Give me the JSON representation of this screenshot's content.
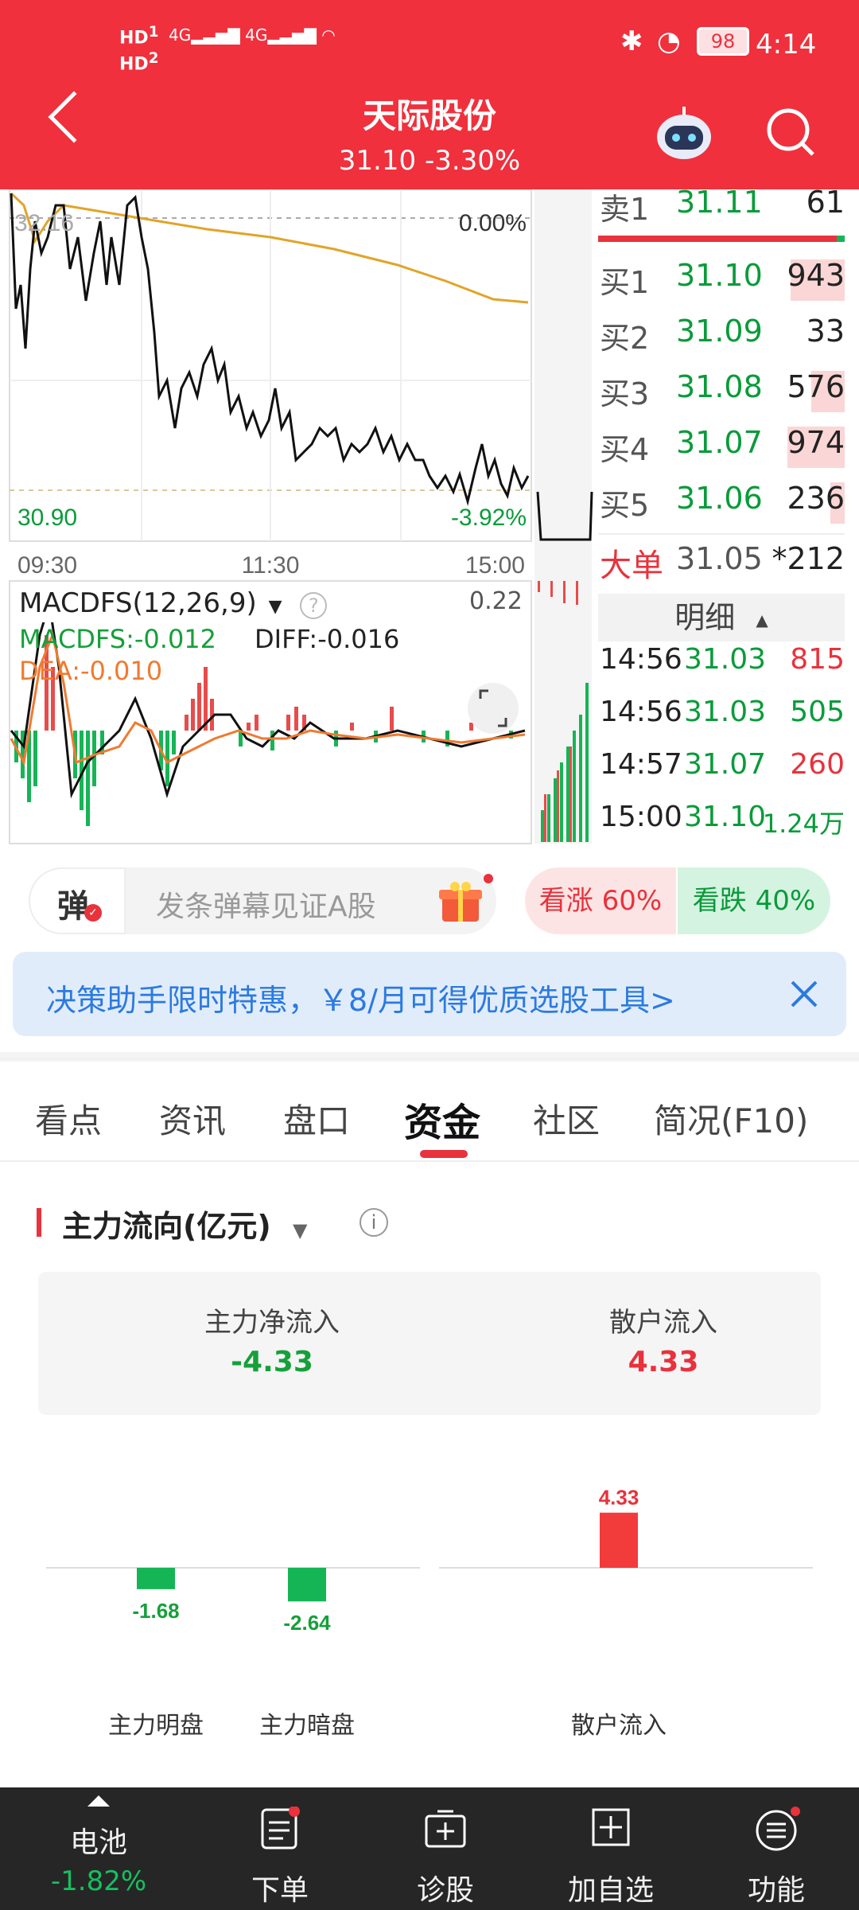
{
  "status_bar": {
    "network": "HD 4G 4G",
    "battery": "98",
    "time": "4:14"
  },
  "header": {
    "title": "天际股份",
    "price": "31.10",
    "change_pct": "-3.30%",
    "back": "back",
    "robot": "robot-assistant",
    "search": "search"
  },
  "chart": {
    "top_left_price": "32.16",
    "top_right_pct": "0.00%",
    "bottom_left_price": "30.90",
    "bottom_right_pct": "-3.92%",
    "times": [
      "09:30",
      "11:30",
      "15:00"
    ],
    "macd_title": "MACDFS(12,26,9)",
    "macd_top_value": "0.22",
    "macdfs_value": "MACDFS:-0.012",
    "diff_value": "DIFF:-0.016",
    "dea_value": "DEA:-0.010"
  },
  "order_book": {
    "sell_top": {
      "label": "卖1",
      "price": "31.11",
      "volume": "61"
    },
    "buys": [
      {
        "label": "买1",
        "price": "31.10",
        "volume": "943",
        "bar": 0.68
      },
      {
        "label": "买2",
        "price": "31.09",
        "volume": "33",
        "bar": 0.0
      },
      {
        "label": "买3",
        "price": "31.08",
        "volume": "576",
        "bar": 0.42
      },
      {
        "label": "买4",
        "price": "31.07",
        "volume": "974",
        "bar": 0.72
      },
      {
        "label": "买5",
        "price": "31.06",
        "volume": "236",
        "bar": 0.18
      }
    ],
    "big_order": {
      "label": "大单",
      "price": "31.05",
      "volume": "*212"
    },
    "detail_label": "明细",
    "ticks": [
      {
        "time": "14:56",
        "price": "31.03",
        "volume": "815",
        "dir": "up"
      },
      {
        "time": "14:56",
        "price": "31.03",
        "volume": "505",
        "dir": "down"
      },
      {
        "time": "14:57",
        "price": "31.07",
        "volume": "260",
        "dir": "up"
      },
      {
        "time": "15:00",
        "price": "31.10",
        "volume": "1.24万",
        "dir": "down"
      }
    ]
  },
  "barrage": {
    "icon_label": "弹",
    "placeholder": "发条弹幕见证A股",
    "vote_up": "看涨 60%",
    "vote_down": "看跌 40%",
    "up_pct": 60
  },
  "promo": {
    "text": "决策助手限时特惠，￥8/月可得优质选股工具>"
  },
  "tabs": [
    "看点",
    "资讯",
    "盘口",
    "资金",
    "社区",
    "简况(F10)"
  ],
  "active_tab": "资金",
  "fund_flow": {
    "title": "主力流向(亿元)",
    "main_net_label": "主力净流入",
    "main_net_value": "-4.33",
    "retail_label": "散户流入",
    "retail_value": "4.33"
  },
  "chart_data": {
    "type": "bar",
    "categories": [
      "主力明盘",
      "主力暗盘",
      "散户流入"
    ],
    "values": [
      -1.68,
      -2.64,
      4.33
    ],
    "value_labels": [
      "-1.68",
      "-2.64",
      "4.33"
    ],
    "colors": [
      "#15b556",
      "#15b556",
      "#f23b3b"
    ]
  },
  "bottom_nav": {
    "items": [
      {
        "label": "电池",
        "value": "-1.82%"
      },
      {
        "label": "下单"
      },
      {
        "label": "诊股"
      },
      {
        "label": "加自选"
      },
      {
        "label": "功能"
      }
    ]
  }
}
